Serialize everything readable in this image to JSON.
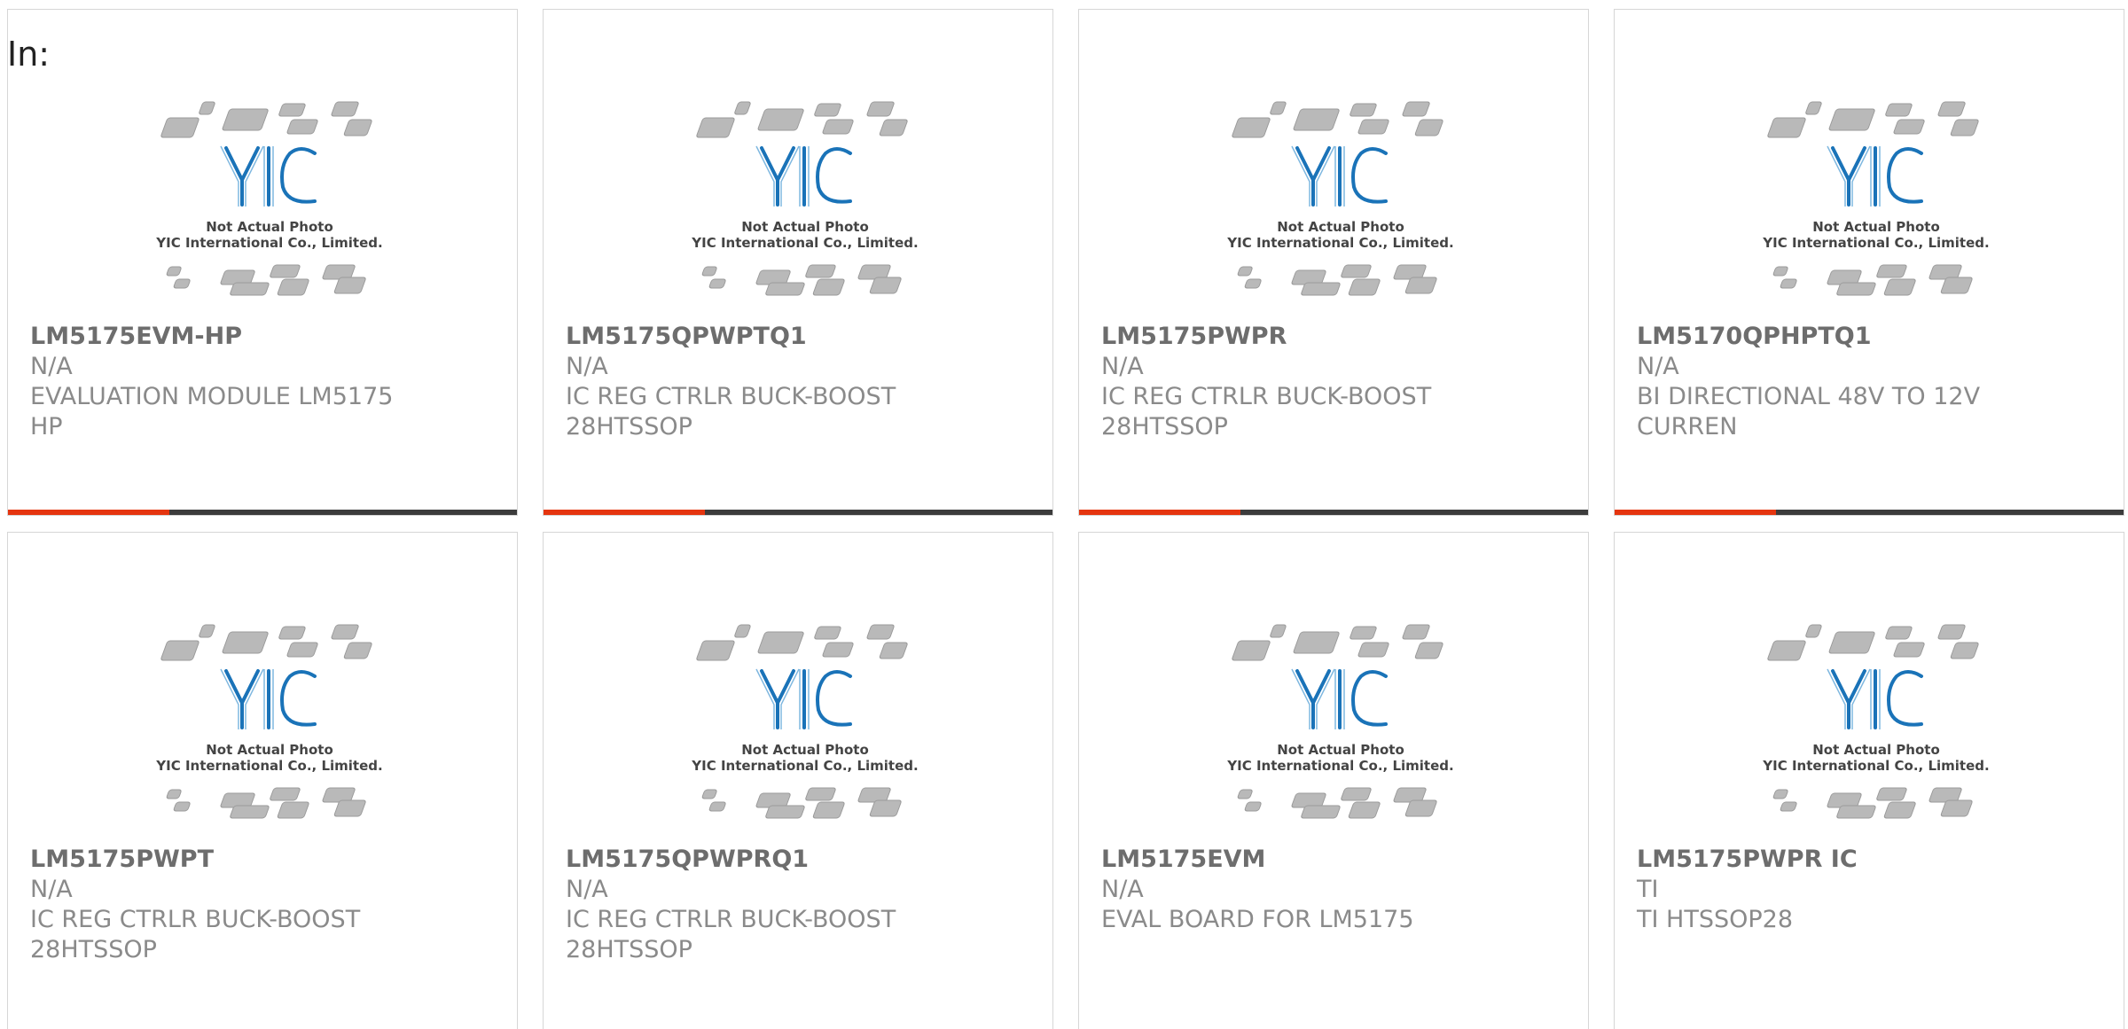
{
  "header": {
    "label": "In:"
  },
  "photo": {
    "brand": "YIC",
    "line1": "Not Actual Photo",
    "line2": "YIC International Co., Limited."
  },
  "colors": {
    "accent": "#e5350f",
    "bar": "#3c3c3c",
    "logo": "#1a73b8"
  },
  "products": [
    {
      "part": "LM5175EVM-HP",
      "manufacturer": "N/A",
      "description": "EVALUATION MODULE LM5175 HP"
    },
    {
      "part": "LM5175QPWPTQ1",
      "manufacturer": "N/A",
      "description": "IC REG CTRLR BUCK-BOOST 28HTSSOP"
    },
    {
      "part": "LM5175PWPR",
      "manufacturer": "N/A",
      "description": "IC REG CTRLR BUCK-BOOST 28HTSSOP"
    },
    {
      "part": "LM5170QPHPTQ1",
      "manufacturer": "N/A",
      "description": "BI DIRECTIONAL 48V TO 12V CURREN"
    },
    {
      "part": "LM5175PWPT",
      "manufacturer": "N/A",
      "description": "IC REG CTRLR BUCK-BOOST 28HTSSOP"
    },
    {
      "part": "LM5175QPWPRQ1",
      "manufacturer": "N/A",
      "description": "IC REG CTRLR BUCK-BOOST 28HTSSOP"
    },
    {
      "part": "LM5175EVM",
      "manufacturer": "N/A",
      "description": "EVAL BOARD FOR LM5175"
    },
    {
      "part": "LM5175PWPR IC",
      "manufacturer": "TI",
      "description": "TI HTSSOP28"
    }
  ]
}
